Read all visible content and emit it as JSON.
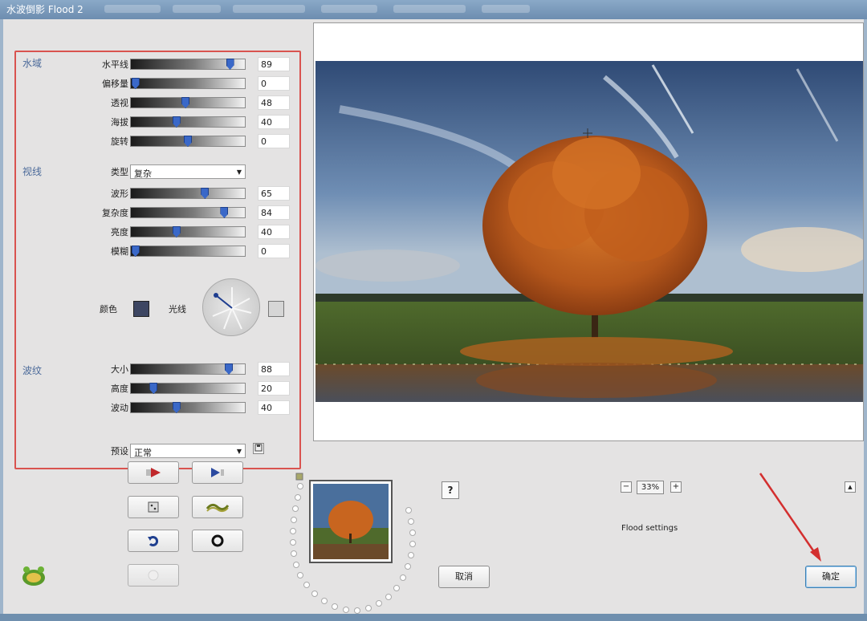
{
  "window": {
    "title": "水波倒影 Flood 2"
  },
  "sections": {
    "water": "水域",
    "waves": "视线",
    "ripples": "波纹"
  },
  "water_rows": [
    {
      "label": "水平线",
      "value": "89",
      "level": 0.87
    },
    {
      "label": "偏移量",
      "value": "0",
      "level": 0.04
    },
    {
      "label": "透视",
      "value": "48",
      "level": 0.48
    },
    {
      "label": "海拔",
      "value": "40",
      "level": 0.4
    },
    {
      "label": "旋转",
      "value": "0",
      "level": 0.5
    }
  ],
  "wave_type": {
    "label": "类型",
    "value": "复杂"
  },
  "wave_rows": [
    {
      "label": "波形",
      "value": "65",
      "level": 0.65
    },
    {
      "label": "复杂度",
      "value": "84",
      "level": 0.82
    },
    {
      "label": "亮度",
      "value": "40",
      "level": 0.4
    },
    {
      "label": "模糊",
      "value": "0",
      "level": 0.04
    }
  ],
  "color_label": "颜色",
  "light_label": "光线",
  "ripple_rows": [
    {
      "label": "大小",
      "value": "88",
      "level": 0.86
    },
    {
      "label": "高度",
      "value": "20",
      "level": 0.2
    },
    {
      "label": "波动",
      "value": "40",
      "level": 0.4
    }
  ],
  "preset": {
    "label": "预设",
    "value": "正常"
  },
  "zoom": {
    "value": "33%",
    "minus": "−",
    "plus": "+"
  },
  "status": "Flood settings",
  "help_label": "?",
  "cancel_label": "取消",
  "ok_label": "确定",
  "colors": {
    "accent_red": "#d9534f",
    "slider_thumb": "#3a68c8",
    "swatch_dark": "#3d4662"
  }
}
